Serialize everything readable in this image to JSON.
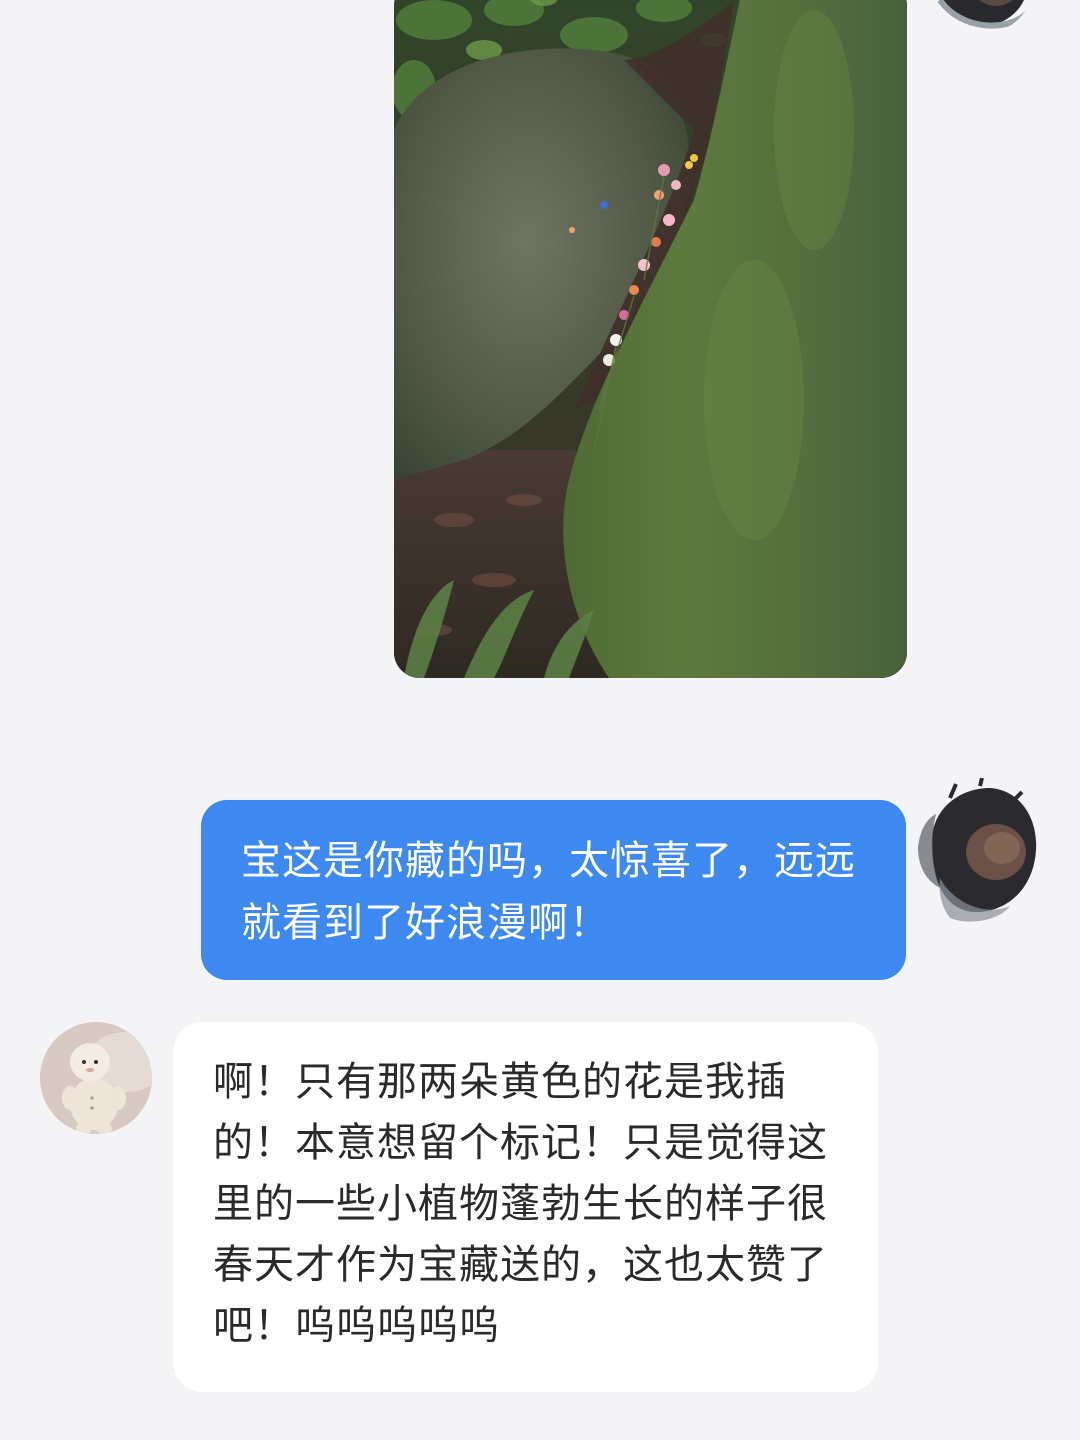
{
  "messages": {
    "outgoing_text": "宝这是你藏的吗，太惊喜了，远远就看到了好浪漫啊！",
    "incoming_text": "啊！只有那两朵黄色的花是我插的！本意想留个标记！只是觉得这里的一些小植物蓬勃生长的样子很春天才作为宝藏送的，这也太赞了吧！呜呜呜呜呜"
  },
  "colors": {
    "outgoing_bubble": "#3d89ef",
    "incoming_bubble": "#ffffff",
    "background": "#f4f4f6"
  },
  "icons": {
    "shared_photo": "forest-rock-flowers-photo",
    "my_avatar": "ink-splash-avatar",
    "friend_avatar": "plush-toy-avatar"
  }
}
